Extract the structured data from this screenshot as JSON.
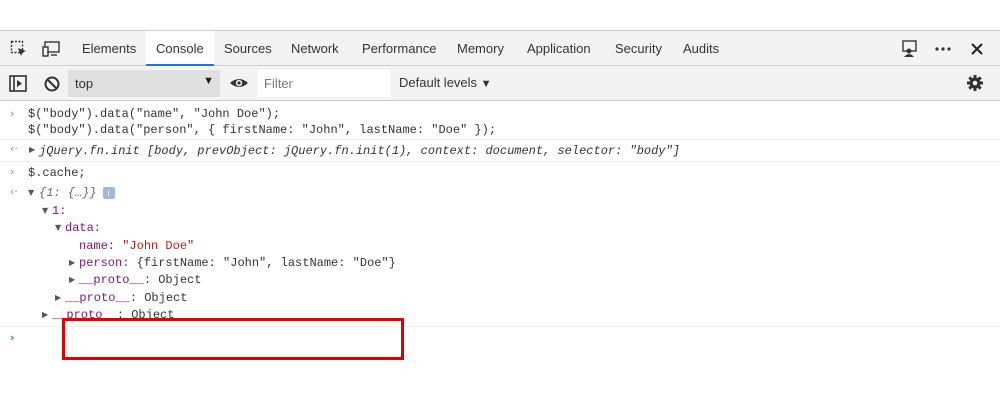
{
  "tabs": [
    {
      "label": "Elements"
    },
    {
      "label": "Console"
    },
    {
      "label": "Sources"
    },
    {
      "label": "Network"
    },
    {
      "label": "Performance"
    },
    {
      "label": "Memory"
    },
    {
      "label": "Application"
    },
    {
      "label": "Security"
    },
    {
      "label": "Audits"
    }
  ],
  "toolbar": {
    "context": "top",
    "filter_placeholder": "Filter",
    "levels": "Default levels"
  },
  "console": {
    "input1_line1": "$(\"body\").data(\"name\", \"John Doe\");",
    "input1_line2": "$(\"body\").data(\"person\", { firstName: \"John\", lastName: \"Doe\" });",
    "output1": "jQuery.fn.init [body, prevObject: jQuery.fn.init(1), context: document, selector: \"body\"]",
    "input2": "$.cache;",
    "output2_summary": "{1: {…}}",
    "key_1": "1:",
    "key_data": "data:",
    "name_key": "name:",
    "name_value": "\"John Doe\"",
    "person_key": "person:",
    "person_value": "{firstName: \"John\", lastName: \"Doe\"}",
    "proto_key": "__proto__",
    "proto_value": ": Object"
  }
}
